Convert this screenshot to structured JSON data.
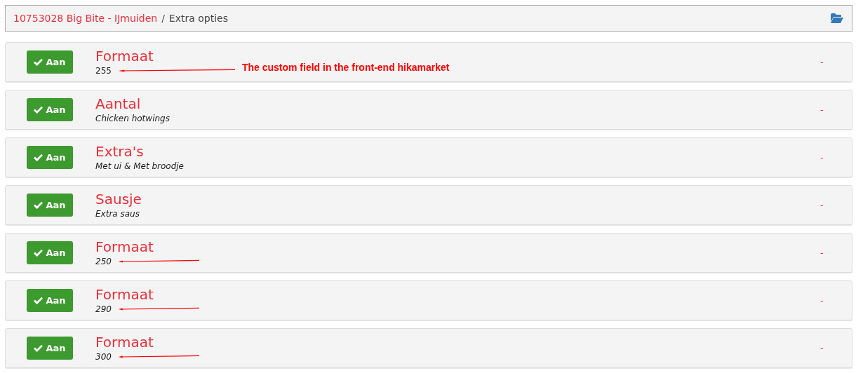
{
  "breadcrumb": {
    "link": "10753028 Big Bite - IJmuiden",
    "separator": "/",
    "current": "Extra opties"
  },
  "rows": [
    {
      "toggle": {
        "label": "Aan",
        "on": true
      },
      "title": "Formaat",
      "detail": "255",
      "italic": false,
      "value": "-",
      "arrow": true,
      "note": "The custom field in the front-end hikamarket"
    },
    {
      "toggle": {
        "label": "Aan",
        "on": true
      },
      "title": "Aantal",
      "detail": "Chicken hotwings",
      "italic": true,
      "value": "-",
      "arrow": false
    },
    {
      "toggle": {
        "label": "Aan",
        "on": true
      },
      "title": "Extra's",
      "detail": "Met ui & Met broodje",
      "italic": true,
      "value": "-",
      "arrow": false
    },
    {
      "toggle": {
        "label": "Aan",
        "on": true
      },
      "title": "Sausje",
      "detail": "Extra saus",
      "italic": true,
      "value": "-",
      "arrow": false
    },
    {
      "toggle": {
        "label": "Aan",
        "on": true
      },
      "title": "Formaat",
      "detail": "250",
      "italic": true,
      "value": "-",
      "arrow": true
    },
    {
      "toggle": {
        "label": "Aan",
        "on": true
      },
      "title": "Formaat",
      "detail": "290",
      "italic": true,
      "value": "-",
      "arrow": true
    },
    {
      "toggle": {
        "label": "Aan",
        "on": true
      },
      "title": "Formaat",
      "detail": "300",
      "italic": true,
      "value": "-",
      "arrow": true
    }
  ]
}
